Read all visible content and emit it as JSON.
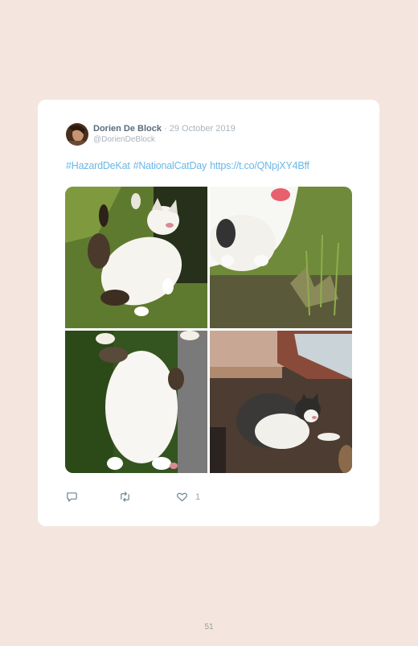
{
  "tweet": {
    "author_name": "Dorien De Block",
    "separator": "·",
    "date": "29 October 2019",
    "handle": "@DorienDeBlock",
    "hashtags": [
      "#HazardDeKat",
      "#NationalCatDay"
    ],
    "link": "https://t.co/QNpjXY4Bff",
    "like_count": "1"
  },
  "icons": [
    "reply-icon",
    "retweet-icon",
    "heart-icon"
  ],
  "colors": {
    "page_background": "#f4e6df",
    "card_background": "#ffffff",
    "link_blue": "#6ab7e6",
    "muted_text": "#a9b4bd"
  },
  "page": {
    "number": "51"
  }
}
